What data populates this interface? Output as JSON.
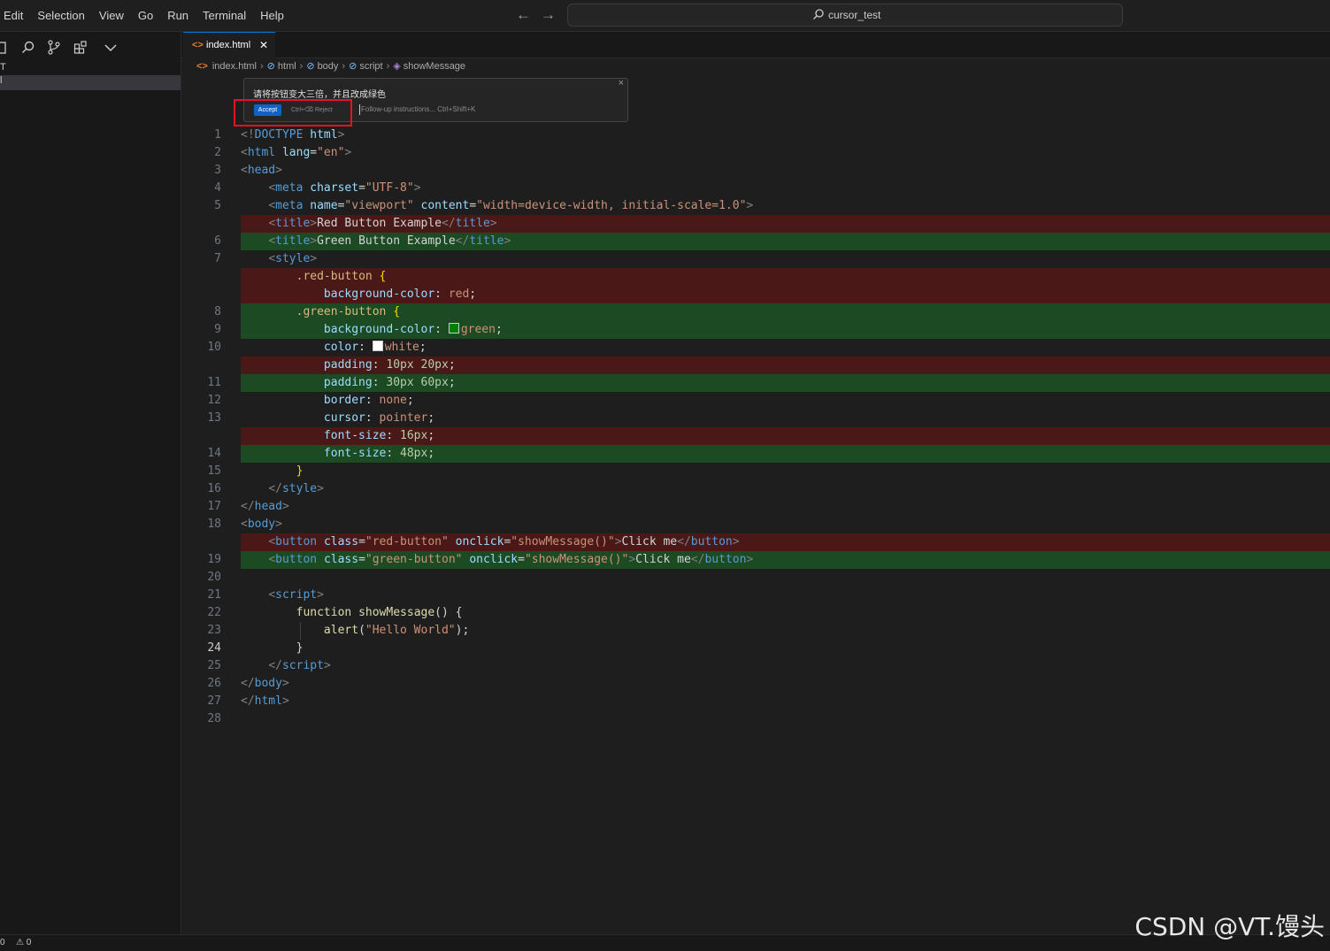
{
  "menu": [
    "Edit",
    "Selection",
    "View",
    "Go",
    "Run",
    "Terminal",
    "Help"
  ],
  "search": {
    "label": "cursor_test"
  },
  "tab": {
    "label": "index.html",
    "close": "✕"
  },
  "breadcrumb": [
    "index.html",
    "html",
    "body",
    "script",
    "showMessage"
  ],
  "prompt": {
    "question": "请将按钮变大三倍，并且改成绿色",
    "accept": "Accept",
    "hint": "Ctrl+⌫ Reject",
    "followup": "Follow-up instructions... Ctrl+Shift+K",
    "close": "×"
  },
  "sidebar": {
    "row1": "T",
    "row2": "l"
  },
  "status": {
    "left": "0",
    "errors": "⚠ 0"
  },
  "watermark": "CSDN @VT.馒头",
  "code": [
    {
      "n": "1",
      "kind": "",
      "html": "<span class='c-br'>&lt;!</span><span class='c-tag'>DOCTYPE</span> <span class='c-att'>html</span><span class='c-br'>&gt;</span>"
    },
    {
      "n": "2",
      "kind": "",
      "html": "<span class='c-br'>&lt;</span><span class='c-tag'>html</span> <span class='c-att'>lang</span>=<span class='c-str'>\"en\"</span><span class='c-br'>&gt;</span>"
    },
    {
      "n": "3",
      "kind": "",
      "html": "<span class='c-br'>&lt;</span><span class='c-tag'>head</span><span class='c-br'>&gt;</span>"
    },
    {
      "n": "4",
      "kind": "",
      "html": "    <span class='c-br'>&lt;</span><span class='c-tag'>meta</span> <span class='c-att'>charset</span>=<span class='c-str'>\"UTF-8\"</span><span class='c-br'>&gt;</span>"
    },
    {
      "n": "5",
      "kind": "",
      "html": "    <span class='c-br'>&lt;</span><span class='c-tag'>meta</span> <span class='c-att'>name</span>=<span class='c-str'>\"viewport\"</span> <span class='c-att'>content</span>=<span class='c-str'>\"width=device-width, initial-scale=1.0\"</span><span class='c-br'>&gt;</span>"
    },
    {
      "n": "",
      "kind": "del",
      "html": "    <span class='c-br'>&lt;</span><span class='c-tag'>title</span><span class='c-br'>&gt;</span>Red Button Example<span class='c-br'>&lt;/</span><span class='c-tag'>title</span><span class='c-br'>&gt;</span>"
    },
    {
      "n": "6",
      "kind": "ins",
      "html": "    <span class='c-br'>&lt;</span><span class='c-tag'>title</span><span class='c-br'>&gt;</span>Green Button Example<span class='c-br'>&lt;/</span><span class='c-tag'>title</span><span class='c-br'>&gt;</span>"
    },
    {
      "n": "7",
      "kind": "",
      "html": "    <span class='c-br'>&lt;</span><span class='c-tag'>style</span><span class='c-br'>&gt;</span>"
    },
    {
      "n": "",
      "kind": "del",
      "html": "        <span class='c-sel'>.red-button</span> <span class='c-brace'>{</span>"
    },
    {
      "n": "",
      "kind": "del",
      "html": "            <span class='c-prop'>background-color</span>: <span class='c-val'>red</span>;"
    },
    {
      "n": "8",
      "kind": "ins",
      "html": "        <span class='c-sel'>.green-button</span> <span class='c-brace'>{</span>"
    },
    {
      "n": "9",
      "kind": "ins",
      "html": "            <span class='c-prop'>background-color</span>: <span class='swatch' style='background:green'></span><span class='c-val'>green</span>;"
    },
    {
      "n": "10",
      "kind": "",
      "html": "            <span class='c-prop'>color</span>: <span class='swatch' style='background:white'></span><span class='c-val'>white</span>;"
    },
    {
      "n": "",
      "kind": "del",
      "html": "            <span class='c-prop'>padding</span>: <span class='c-num'>10px</span> <span class='c-num'>20px</span>;"
    },
    {
      "n": "11",
      "kind": "ins",
      "html": "            <span class='c-prop'>padding</span>: <span class='c-num'>30px</span> <span class='c-num'>60px</span>;"
    },
    {
      "n": "12",
      "kind": "",
      "html": "            <span class='c-prop'>border</span>: <span class='c-val'>none</span>;"
    },
    {
      "n": "13",
      "kind": "",
      "html": "            <span class='c-prop'>cursor</span>: <span class='c-val'>pointer</span>;"
    },
    {
      "n": "",
      "kind": "del",
      "html": "            <span class='c-prop'>font-size</span>: <span class='c-num'>16px</span>;"
    },
    {
      "n": "14",
      "kind": "ins",
      "html": "            <span class='c-prop'>font-size</span>: <span class='c-num'>48px</span>;"
    },
    {
      "n": "15",
      "kind": "",
      "html": "        <span class='c-brace'>}</span>"
    },
    {
      "n": "16",
      "kind": "",
      "html": "    <span class='c-br'>&lt;/</span><span class='c-tag'>style</span><span class='c-br'>&gt;</span>"
    },
    {
      "n": "17",
      "kind": "",
      "html": "<span class='c-br'>&lt;/</span><span class='c-tag'>head</span><span class='c-br'>&gt;</span>"
    },
    {
      "n": "18",
      "kind": "",
      "html": "<span class='c-br'>&lt;</span><span class='c-tag'>body</span><span class='c-br'>&gt;</span>"
    },
    {
      "n": "",
      "kind": "del",
      "html": "    <span class='c-br'>&lt;</span><span class='c-tag'>button</span> <span class='c-att'>class</span>=<span class='c-str'>\"red-button\"</span> <span class='c-att'>onclick</span>=<span class='c-str'>\"showMessage()\"</span><span class='c-br'>&gt;</span>Click me<span class='c-br'>&lt;/</span><span class='c-tag'>button</span><span class='c-br'>&gt;</span>"
    },
    {
      "n": "19",
      "kind": "ins",
      "html": "    <span class='c-br'>&lt;</span><span class='c-tag'>button</span> <span class='c-att'>class</span>=<span class='c-str'>\"green-button\"</span> <span class='c-att'>onclick</span>=<span class='c-str'>\"showMessage()\"</span><span class='c-br'>&gt;</span>Click me<span class='c-br'>&lt;/</span><span class='c-tag'>button</span><span class='c-br'>&gt;</span>"
    },
    {
      "n": "20",
      "kind": "",
      "html": ""
    },
    {
      "n": "21",
      "kind": "",
      "html": "    <span class='c-br'>&lt;</span><span class='c-tag'>script</span><span class='c-br'>&gt;</span>"
    },
    {
      "n": "22",
      "kind": "",
      "html": "        <span class='c-kw'>function</span> <span class='c-fn'>showMessage</span>() {"
    },
    {
      "n": "23",
      "kind": "",
      "html": "            <span class='c-fn'>alert</span>(<span class='c-str'>\"Hello World\"</span>);"
    },
    {
      "n": "24",
      "kind": "active",
      "html": "        }"
    },
    {
      "n": "25",
      "kind": "",
      "html": "    <span class='c-br'>&lt;/</span><span class='c-tag'>script</span><span class='c-br'>&gt;</span>"
    },
    {
      "n": "26",
      "kind": "",
      "html": "<span class='c-br'>&lt;/</span><span class='c-tag'>body</span><span class='c-br'>&gt;</span>"
    },
    {
      "n": "27",
      "kind": "",
      "html": "<span class='c-br'>&lt;/</span><span class='c-tag'>html</span><span class='c-br'>&gt;</span>"
    },
    {
      "n": "28",
      "kind": "",
      "html": ""
    }
  ]
}
